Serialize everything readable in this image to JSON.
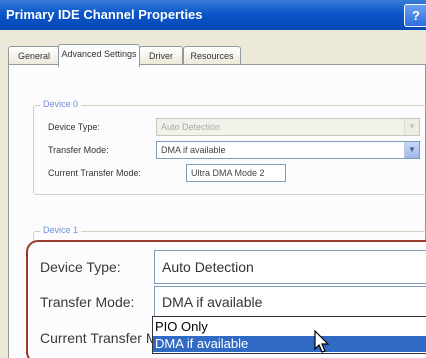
{
  "window": {
    "title": "Primary IDE Channel Properties",
    "help_label": "?"
  },
  "tabs": [
    {
      "label": "General"
    },
    {
      "label": "Advanced Settings",
      "active": true
    },
    {
      "label": "Driver"
    },
    {
      "label": "Resources"
    }
  ],
  "device0": {
    "legend": "Device 0",
    "device_type_label": "Device Type:",
    "device_type_value": "Auto Detection",
    "transfer_mode_label": "Transfer Mode:",
    "transfer_mode_value": "DMA if available",
    "current_mode_label": "Current Transfer Mode:",
    "current_mode_value": "Ultra DMA Mode 2"
  },
  "device1": {
    "legend": "Device 1",
    "device_type_label": "Device Type:",
    "device_type_value": "Auto Detection",
    "transfer_mode_label": "Transfer Mode:",
    "transfer_mode_value": "DMA if available",
    "current_mode_label": "Current Transfer Mode:",
    "dropdown_options": [
      "PIO Only",
      "DMA if available"
    ],
    "dropdown_selected": "DMA if available"
  },
  "colors": {
    "titlebar": "#0a56c9",
    "highlight": "#316ac5",
    "zoom_border": "#9b3a2a",
    "legend": "#6f8fd6"
  },
  "icons": {
    "arrow": "dropdown-arrow-icon",
    "cursor": "mouse-cursor-icon"
  }
}
